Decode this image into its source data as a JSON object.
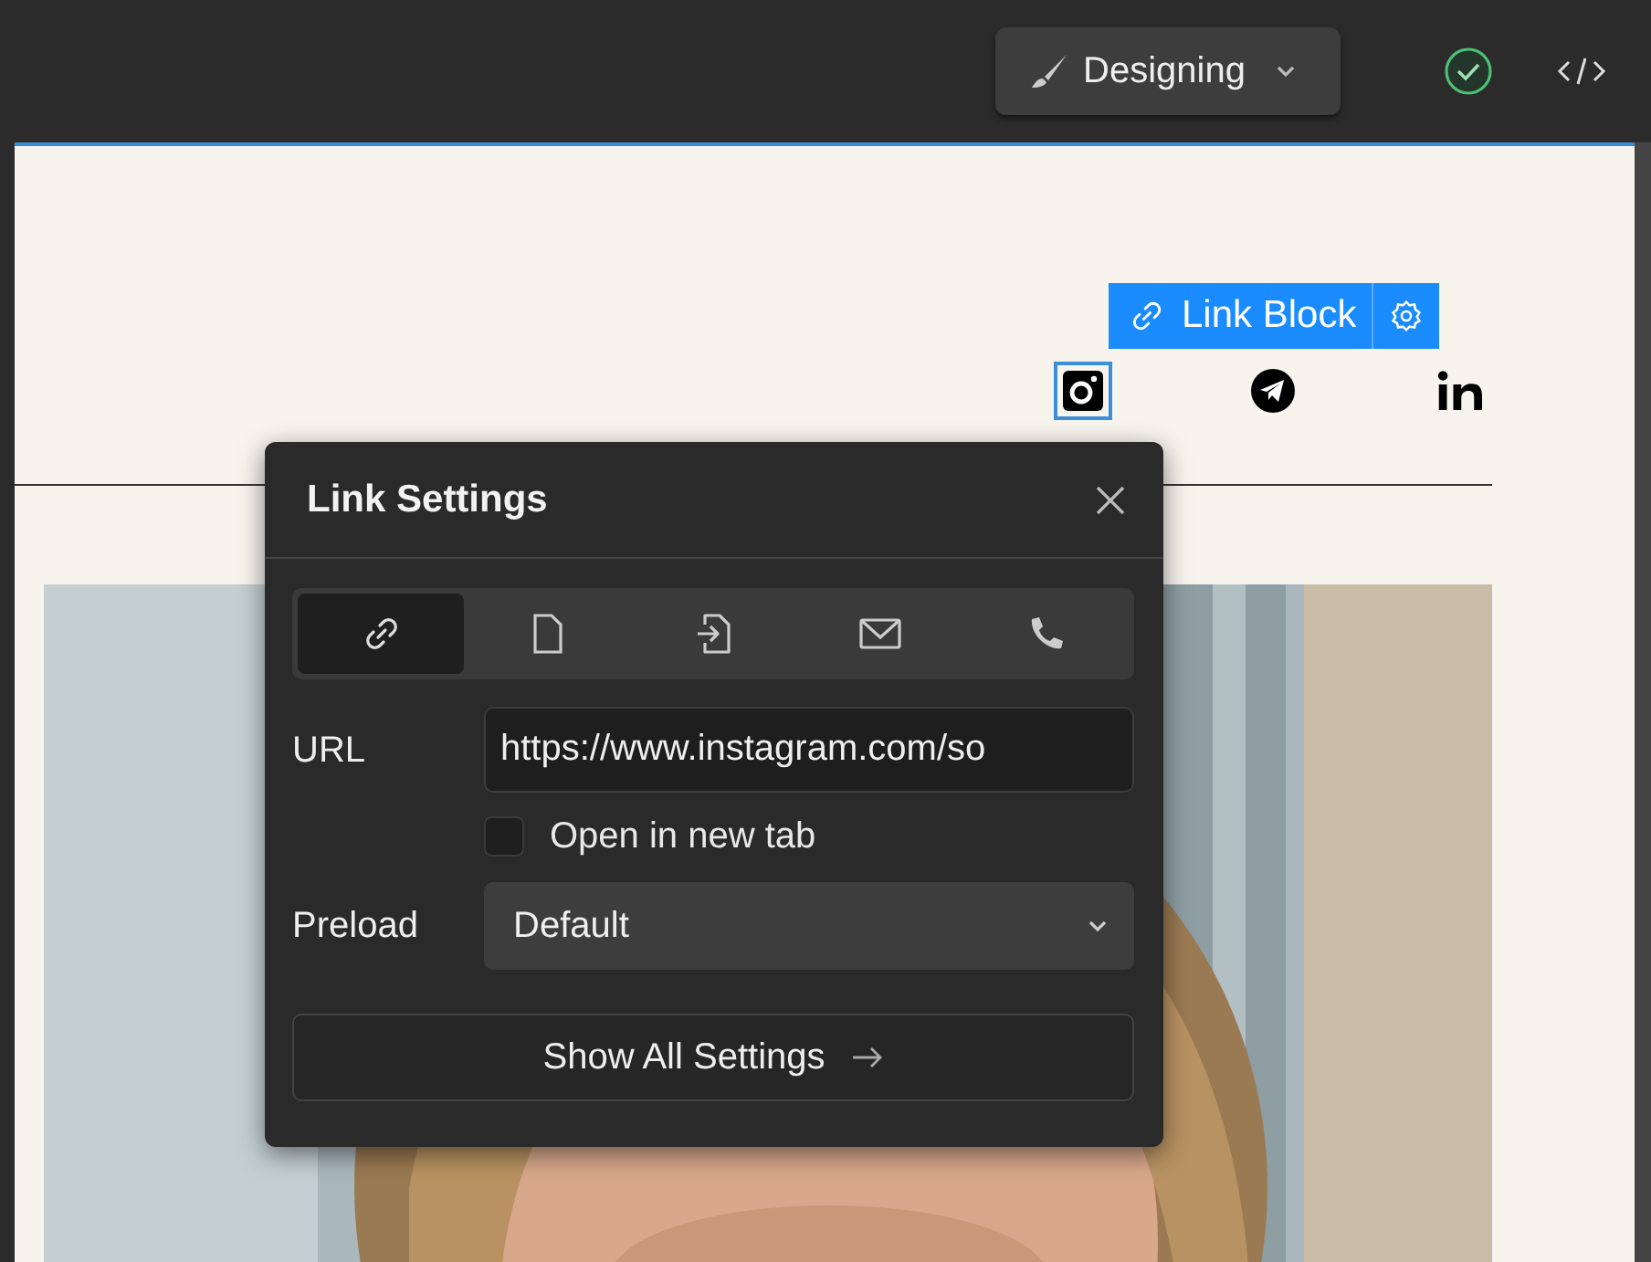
{
  "toolbar": {
    "mode_button": "Designing"
  },
  "canvas": {
    "link_block_label": "Link Block",
    "social_icons": [
      {
        "kind": "instagram",
        "selected": true
      },
      {
        "kind": "telegram",
        "selected": false
      },
      {
        "kind": "linkedin",
        "selected": false
      }
    ]
  },
  "dialog": {
    "title": "Link Settings",
    "tabs": [
      {
        "kind": "url",
        "selected": true
      },
      {
        "kind": "page",
        "selected": false
      },
      {
        "kind": "section",
        "selected": false
      },
      {
        "kind": "email",
        "selected": false
      },
      {
        "kind": "phone",
        "selected": false
      }
    ],
    "url_label": "URL",
    "url_value": "https://www.instagram.com/so",
    "new_tab": {
      "label": "Open in new tab",
      "checked": false
    },
    "preload_label": "Preload",
    "preload_value": "Default",
    "show_all_button": "Show All Settings"
  }
}
